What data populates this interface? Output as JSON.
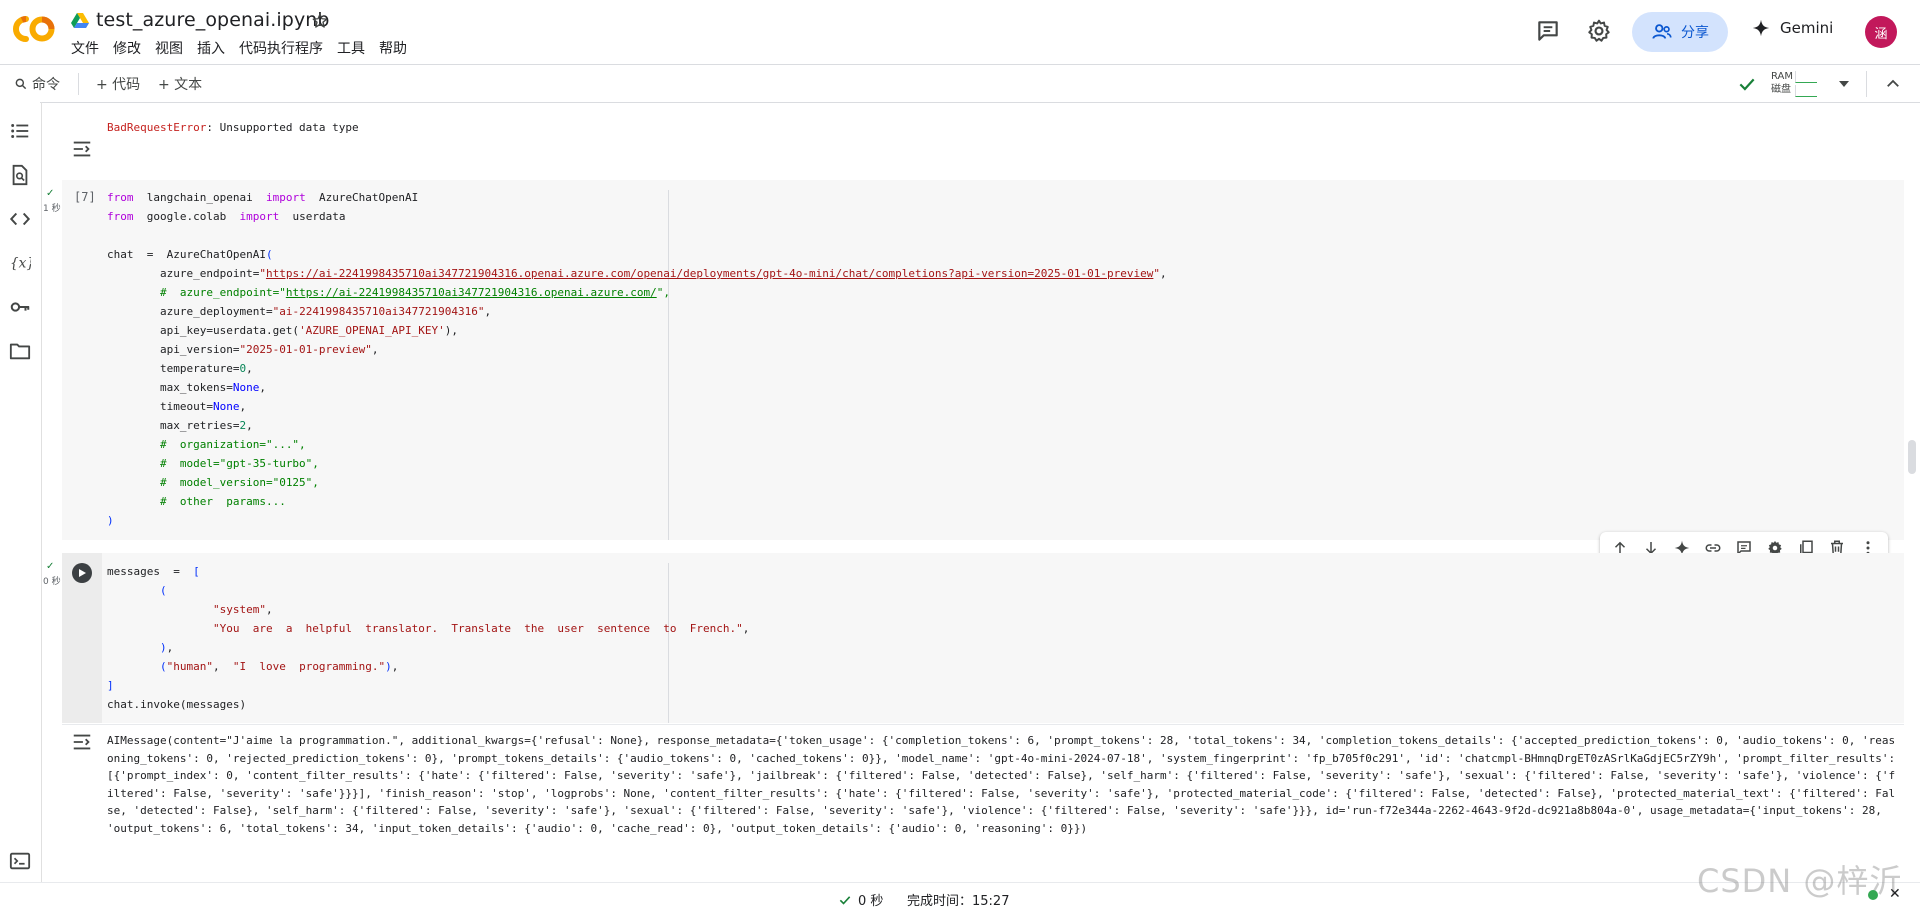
{
  "app": {
    "notebook_title": "test_azure_openai.ipynb",
    "menu": [
      "文件",
      "修改",
      "视图",
      "插入",
      "代码执行程序",
      "工具",
      "帮助"
    ],
    "share_label": "分享",
    "gemini_label": "Gemini",
    "avatar_letter": "涵",
    "brand_color": "#f9ab00"
  },
  "toolbar": {
    "command_label": "命令",
    "add_code_label": "+ 代码",
    "add_text_label": "+ 文本",
    "ram_label": "RAM",
    "disk_label": "磁盘"
  },
  "cells": {
    "error_output": {
      "error_name": "BadRequestError",
      "error_message": ": Unsupported data type"
    },
    "cell1": {
      "execution_count": "[7]",
      "exec_time": "1 秒",
      "endpoint_url": "https://ai-2241998435710ai347721904316.openai.azure.com/openai/deployments/gpt-4o-mini/chat/completions?api-version=2025-01-01-preview",
      "endpoint_url_commented": "https://ai-2241998435710ai347721904316.openai.azure.com/",
      "deployment": "\"ai-2241998435710ai347721904316\"",
      "api_key_arg": "'AZURE_OPENAI_API_KEY'",
      "api_version": "\"2025-01-01-preview\""
    },
    "cell2": {
      "exec_time": "0 秒",
      "system_role": "\"system\"",
      "system_prompt": "\"You  are  a  helpful  translator.  Translate  the  user  sentence  to  French.\"",
      "human_role": "\"human\"",
      "human_prompt": "\"I  love  programming.\""
    },
    "cell2_output": "AIMessage(content=\"J'aime la programmation.\", additional_kwargs={'refusal': None}, response_metadata={'token_usage': {'completion_tokens': 6, 'prompt_tokens': 28, 'total_tokens': 34, 'completion_tokens_details': {'accepted_prediction_tokens': 0, 'audio_tokens': 0, 'reasoning_tokens': 0, 'rejected_prediction_tokens': 0}, 'prompt_tokens_details': {'audio_tokens': 0, 'cached_tokens': 0}}, 'model_name': 'gpt-4o-mini-2024-07-18', 'system_fingerprint': 'fp_b705f0c291', 'id': 'chatcmpl-BHmnqDrgET0zASrlKaGdjEC5rZY9h', 'prompt_filter_results': [{'prompt_index': 0, 'content_filter_results': {'hate': {'filtered': False, 'severity': 'safe'}, 'jailbreak': {'filtered': False, 'detected': False}, 'self_harm': {'filtered': False, 'severity': 'safe'}, 'sexual': {'filtered': False, 'severity': 'safe'}, 'violence': {'filtered': False, 'severity': 'safe'}}}], 'finish_reason': 'stop', 'logprobs': None, 'content_filter_results': {'hate': {'filtered': False, 'severity': 'safe'}, 'protected_material_code': {'filtered': False, 'detected': False}, 'protected_material_text': {'filtered': False, 'detected': False}, 'self_harm': {'filtered': False, 'severity': 'safe'}, 'sexual': {'filtered': False, 'severity': 'safe'}, 'violence': {'filtered': False, 'severity': 'safe'}}}, id='run-f72e344a-2262-4643-9f2d-dc921a8b804a-0', usage_metadata={'input_tokens': 28, 'output_tokens': 6, 'total_tokens': 34, 'input_token_details': {'audio': 0, 'cache_read': 0}, 'output_token_details': {'audio': 0, 'reasoning': 0}})"
  },
  "status": {
    "elapsed": "0 秒",
    "completed_label": "完成时间：15:27",
    "watermark": "CSDN @梓沂"
  }
}
